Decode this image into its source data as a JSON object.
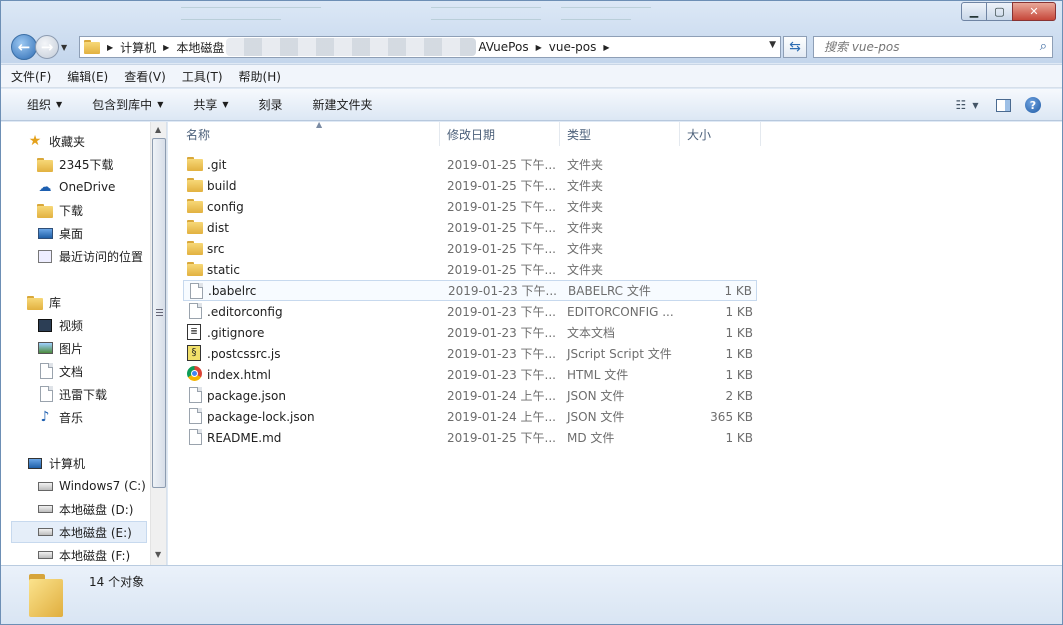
{
  "window": {
    "minimize_icon": "minimize-icon",
    "maximize_icon": "maximize-icon",
    "close_icon": "close-icon"
  },
  "address": {
    "crumbs": [
      "计算机",
      "本地磁盘",
      "AVuePos",
      "vue-pos"
    ]
  },
  "search": {
    "placeholder": "搜索 vue-pos"
  },
  "menu": [
    "文件(F)",
    "编辑(E)",
    "查看(V)",
    "工具(T)",
    "帮助(H)"
  ],
  "toolbar": {
    "organize": "组织",
    "include_in_library": "包含到库中",
    "share": "共享",
    "burn": "刻录",
    "new_folder": "新建文件夹"
  },
  "nav": {
    "favorites": "收藏夹",
    "downloads_2345": "2345下载",
    "onedrive": "OneDrive",
    "downloads": "下载",
    "desktop": "桌面",
    "recent": "最近访问的位置",
    "libraries": "库",
    "videos": "视频",
    "pictures": "图片",
    "documents": "文档",
    "thunder": "迅雷下载",
    "music": "音乐",
    "computer": "计算机",
    "drive_c": "Windows7 (C:)",
    "drive_d": "本地磁盘 (D:)",
    "drive_e": "本地磁盘 (E:)",
    "drive_f": "本地磁盘 (F:)"
  },
  "columns": {
    "name": "名称",
    "date": "修改日期",
    "type": "类型",
    "size": "大小"
  },
  "files": [
    {
      "name": ".git",
      "date": "2019-01-25 下午...",
      "type": "文件夹",
      "size": "",
      "icon": "folder"
    },
    {
      "name": "build",
      "date": "2019-01-25 下午...",
      "type": "文件夹",
      "size": "",
      "icon": "folder"
    },
    {
      "name": "config",
      "date": "2019-01-25 下午...",
      "type": "文件夹",
      "size": "",
      "icon": "folder"
    },
    {
      "name": "dist",
      "date": "2019-01-25 下午...",
      "type": "文件夹",
      "size": "",
      "icon": "folder"
    },
    {
      "name": "src",
      "date": "2019-01-25 下午...",
      "type": "文件夹",
      "size": "",
      "icon": "folder"
    },
    {
      "name": "static",
      "date": "2019-01-25 下午...",
      "type": "文件夹",
      "size": "",
      "icon": "folder"
    },
    {
      "name": ".babelrc",
      "date": "2019-01-23 下午...",
      "type": "BABELRC 文件",
      "size": "1 KB",
      "icon": "doc"
    },
    {
      "name": ".editorconfig",
      "date": "2019-01-23 下午...",
      "type": "EDITORCONFIG ...",
      "size": "1 KB",
      "icon": "doc"
    },
    {
      "name": ".gitignore",
      "date": "2019-01-23 下午...",
      "type": "文本文档",
      "size": "1 KB",
      "icon": "text"
    },
    {
      "name": ".postcssrc.js",
      "date": "2019-01-23 下午...",
      "type": "JScript Script 文件",
      "size": "1 KB",
      "icon": "script"
    },
    {
      "name": "index.html",
      "date": "2019-01-23 下午...",
      "type": "HTML 文件",
      "size": "1 KB",
      "icon": "chrome"
    },
    {
      "name": "package.json",
      "date": "2019-01-24 上午...",
      "type": "JSON 文件",
      "size": "2 KB",
      "icon": "doc"
    },
    {
      "name": "package-lock.json",
      "date": "2019-01-24 上午...",
      "type": "JSON 文件",
      "size": "365 KB",
      "icon": "doc"
    },
    {
      "name": "README.md",
      "date": "2019-01-25 下午...",
      "type": "MD 文件",
      "size": "1 KB",
      "icon": "doc"
    }
  ],
  "status": {
    "count": "14 个对象"
  }
}
